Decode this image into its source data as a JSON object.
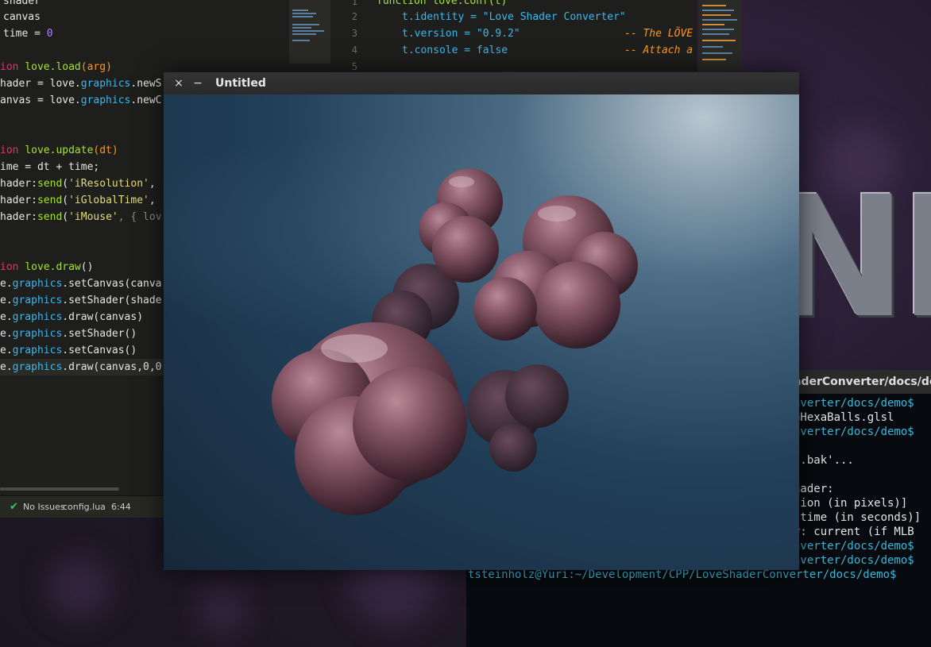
{
  "editor_left": {
    "lines": [
      [
        "shader"
      ],
      [
        "canvas"
      ],
      [
        "time = ",
        "0"
      ],
      [
        "ion ",
        "love.load",
        "(arg)"
      ],
      [
        "hader = love.",
        "graphics",
        ".newS"
      ],
      [
        "anvas = love.",
        "graphics",
        ".newC"
      ],
      [
        "ion ",
        "love.update",
        "(dt)"
      ],
      [
        "ime = dt + time;"
      ],
      [
        "hader:",
        "send",
        "(",
        "'iResolution'",
        ","
      ],
      [
        "hader:",
        "send",
        "(",
        "'iGlobalTime'",
        ","
      ],
      [
        "hader:",
        "send",
        "(",
        "'iMouse'",
        ", { lov"
      ],
      [
        "ion ",
        "love.draw",
        "()"
      ],
      [
        "e.",
        "graphics",
        ".setCanvas(canva"
      ],
      [
        "e.",
        "graphics",
        ".setShader(shade"
      ],
      [
        "e.",
        "graphics",
        ".draw(canvas)"
      ],
      [
        "e.",
        "graphics",
        ".setShader()"
      ],
      [
        "e.",
        "graphics",
        ".setCanvas()"
      ],
      [
        "e.",
        "graphics",
        ".draw(canvas,0,0"
      ]
    ],
    "status": {
      "issues": "No Issues",
      "file": "config.lua",
      "position": "6:44"
    }
  },
  "editor_right": {
    "line_numbers": [
      "1",
      "2",
      "3",
      "4",
      "5"
    ],
    "lines": [
      "function love.conf(t)",
      "t.identity = \"Love Shader Converter\"",
      "t.version = \"0.9.2\"",
      "t.console = false"
    ],
    "comments": [
      "-- The LÖVE",
      "-- Attach a"
    ]
  },
  "window": {
    "title": "Untitled",
    "close_glyph": "×",
    "minimize_glyph": "−"
  },
  "terminal": {
    "title": "aderConverter/docs/dem",
    "lines": [
      "nverter/docs/demo$",
      "aHexaBalls.glsl",
      "nverter/docs/demo$",
      "",
      "..bak'...",
      "",
      "hader:",
      "tion (in pixels)]",
      " time (in seconds)]",
      "y: current (if MLB",
      "nverter/docs/demo$",
      "nverter/docs/demo$",
      "tsteinholz@Yuri:~/Development/CPP/LoveShaderConverter/docs/demo$"
    ]
  },
  "backdrop_logo": "NE",
  "colors": {
    "keyword": "#f92672",
    "function": "#a6e22e",
    "api": "#39b8f0",
    "string": "#e6db74",
    "terminal_text": "#39b8d8",
    "blob": "#8a5a6a"
  }
}
